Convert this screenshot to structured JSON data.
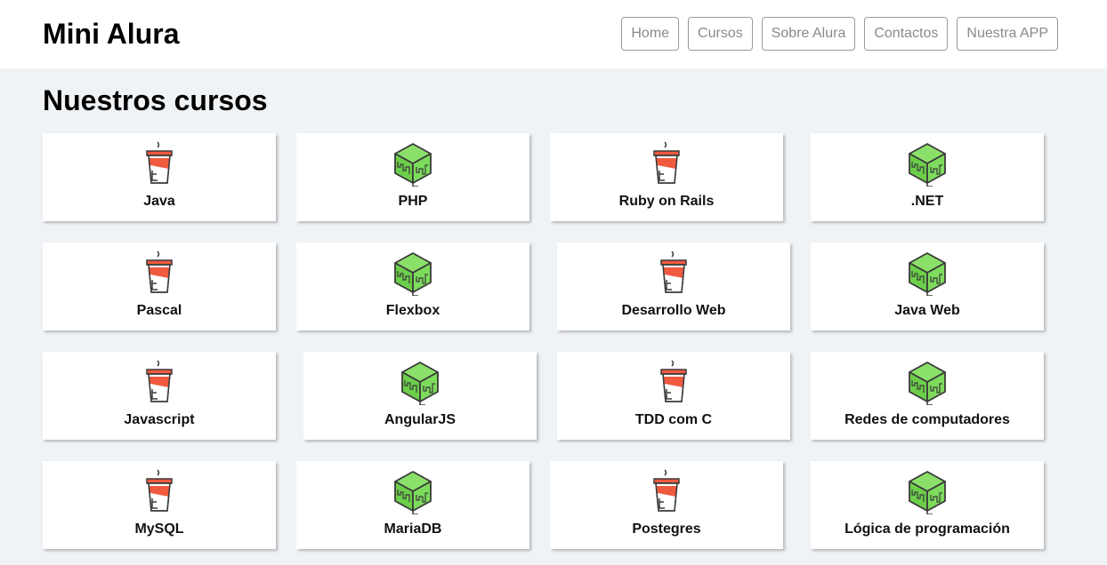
{
  "header": {
    "brand": "Mini Alura",
    "nav": [
      "Home",
      "Cursos",
      "Sobre Alura",
      "Contactos",
      "Nuestra APP"
    ]
  },
  "main": {
    "title": "Nuestros cursos",
    "courses": [
      {
        "name": "Java",
        "icon": "coffee-cup-icon"
      },
      {
        "name": "PHP",
        "icon": "cube-icon"
      },
      {
        "name": "Ruby on Rails",
        "icon": "coffee-cup-icon"
      },
      {
        "name": ".NET",
        "icon": "cube-icon"
      },
      {
        "name": "Pascal",
        "icon": "coffee-cup-icon"
      },
      {
        "name": "Flexbox",
        "icon": "cube-icon"
      },
      {
        "name": "Desarrollo Web",
        "icon": "coffee-cup-icon"
      },
      {
        "name": "Java Web",
        "icon": "cube-icon"
      },
      {
        "name": "Javascript",
        "icon": "coffee-cup-icon"
      },
      {
        "name": "AngularJS",
        "icon": "cube-icon"
      },
      {
        "name": "TDD com C",
        "icon": "coffee-cup-icon"
      },
      {
        "name": "Redes de computadores",
        "icon": "cube-icon"
      },
      {
        "name": "MySQL",
        "icon": "coffee-cup-icon"
      },
      {
        "name": "MariaDB",
        "icon": "cube-icon"
      },
      {
        "name": "Postegres",
        "icon": "coffee-cup-icon"
      },
      {
        "name": "Lógica de programación",
        "icon": "cube-icon"
      }
    ]
  },
  "colors": {
    "cup_red": "#f05a3f",
    "cube_green": "#7ddc5c",
    "outline": "#3a3a3a"
  }
}
